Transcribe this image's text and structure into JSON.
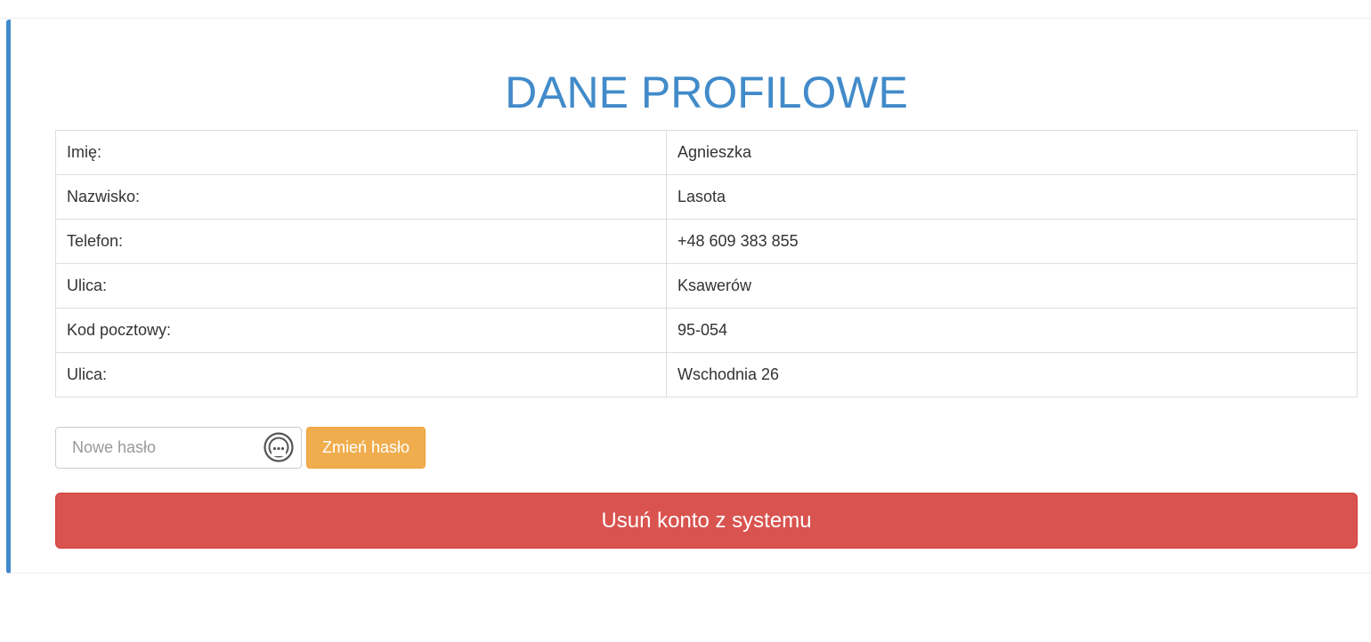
{
  "header": {
    "title": "DANE PROFILOWE"
  },
  "profile": {
    "rows": [
      {
        "label": "Imię:",
        "value": "Agnieszka"
      },
      {
        "label": "Nazwisko:",
        "value": "Lasota"
      },
      {
        "label": "Telefon:",
        "value": "+48 609 383 855"
      },
      {
        "label": "Ulica:",
        "value": "Ksawerów"
      },
      {
        "label": "Kod pocztowy:",
        "value": "95-054"
      },
      {
        "label": "Ulica:",
        "value": "Wschodnia 26"
      }
    ]
  },
  "password_form": {
    "placeholder": "Nowe hasło",
    "value": "",
    "reveal_icon": "password-reveal-icon",
    "submit_label": "Zmień hasło"
  },
  "delete_account": {
    "label": "Usuń konto z systemu"
  },
  "colors": {
    "accent": "#428bca",
    "warning": "#f0ad4e",
    "danger": "#d9534f"
  }
}
